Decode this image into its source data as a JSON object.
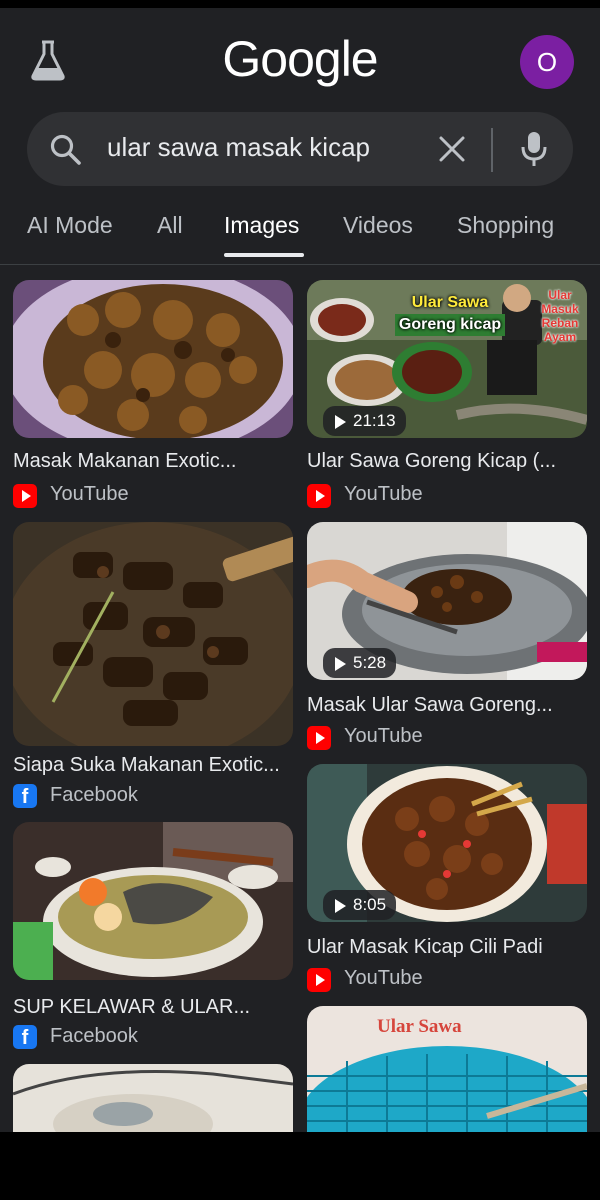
{
  "header": {
    "logo": "Google",
    "avatar_letter": "O"
  },
  "search": {
    "query": "ular sawa masak kicap"
  },
  "tabs": [
    {
      "label": "AI Mode"
    },
    {
      "label": "All"
    },
    {
      "label": "Images"
    },
    {
      "label": "Videos"
    },
    {
      "label": "Shopping"
    }
  ],
  "results": {
    "left": [
      {
        "title": "Masak Makanan Exotic...",
        "source": "YouTube",
        "source_icon": "youtube-icon"
      },
      {
        "title": "Siapa Suka Makanan Exotic...",
        "source": "Facebook",
        "source_icon": "facebook-icon"
      },
      {
        "title": "SUP KELAWAR & ULAR...",
        "source": "Facebook",
        "source_icon": "facebook-icon"
      }
    ],
    "right": [
      {
        "title": "Ular Sawa Goreng Kicap (...",
        "source": "YouTube",
        "source_icon": "youtube-icon",
        "duration": "21:13",
        "overlay": {
          "line1": "Ular Sawa",
          "line2": "Goreng kicap",
          "side": [
            "Ular",
            "Masuk",
            "Reban",
            "Ayam"
          ]
        }
      },
      {
        "title": "Masak Ular Sawa Goreng...",
        "source": "YouTube",
        "source_icon": "youtube-icon",
        "duration": "5:28"
      },
      {
        "title": "Ular Masak Kicap Cili Padi",
        "source": "YouTube",
        "source_icon": "youtube-icon",
        "duration": "8:05"
      },
      {
        "overlay": {
          "line1": "Ular Sawa"
        }
      }
    ]
  },
  "colors": {
    "background": "#202124",
    "search_bg": "#303134",
    "avatar": "#7b1fa2"
  }
}
